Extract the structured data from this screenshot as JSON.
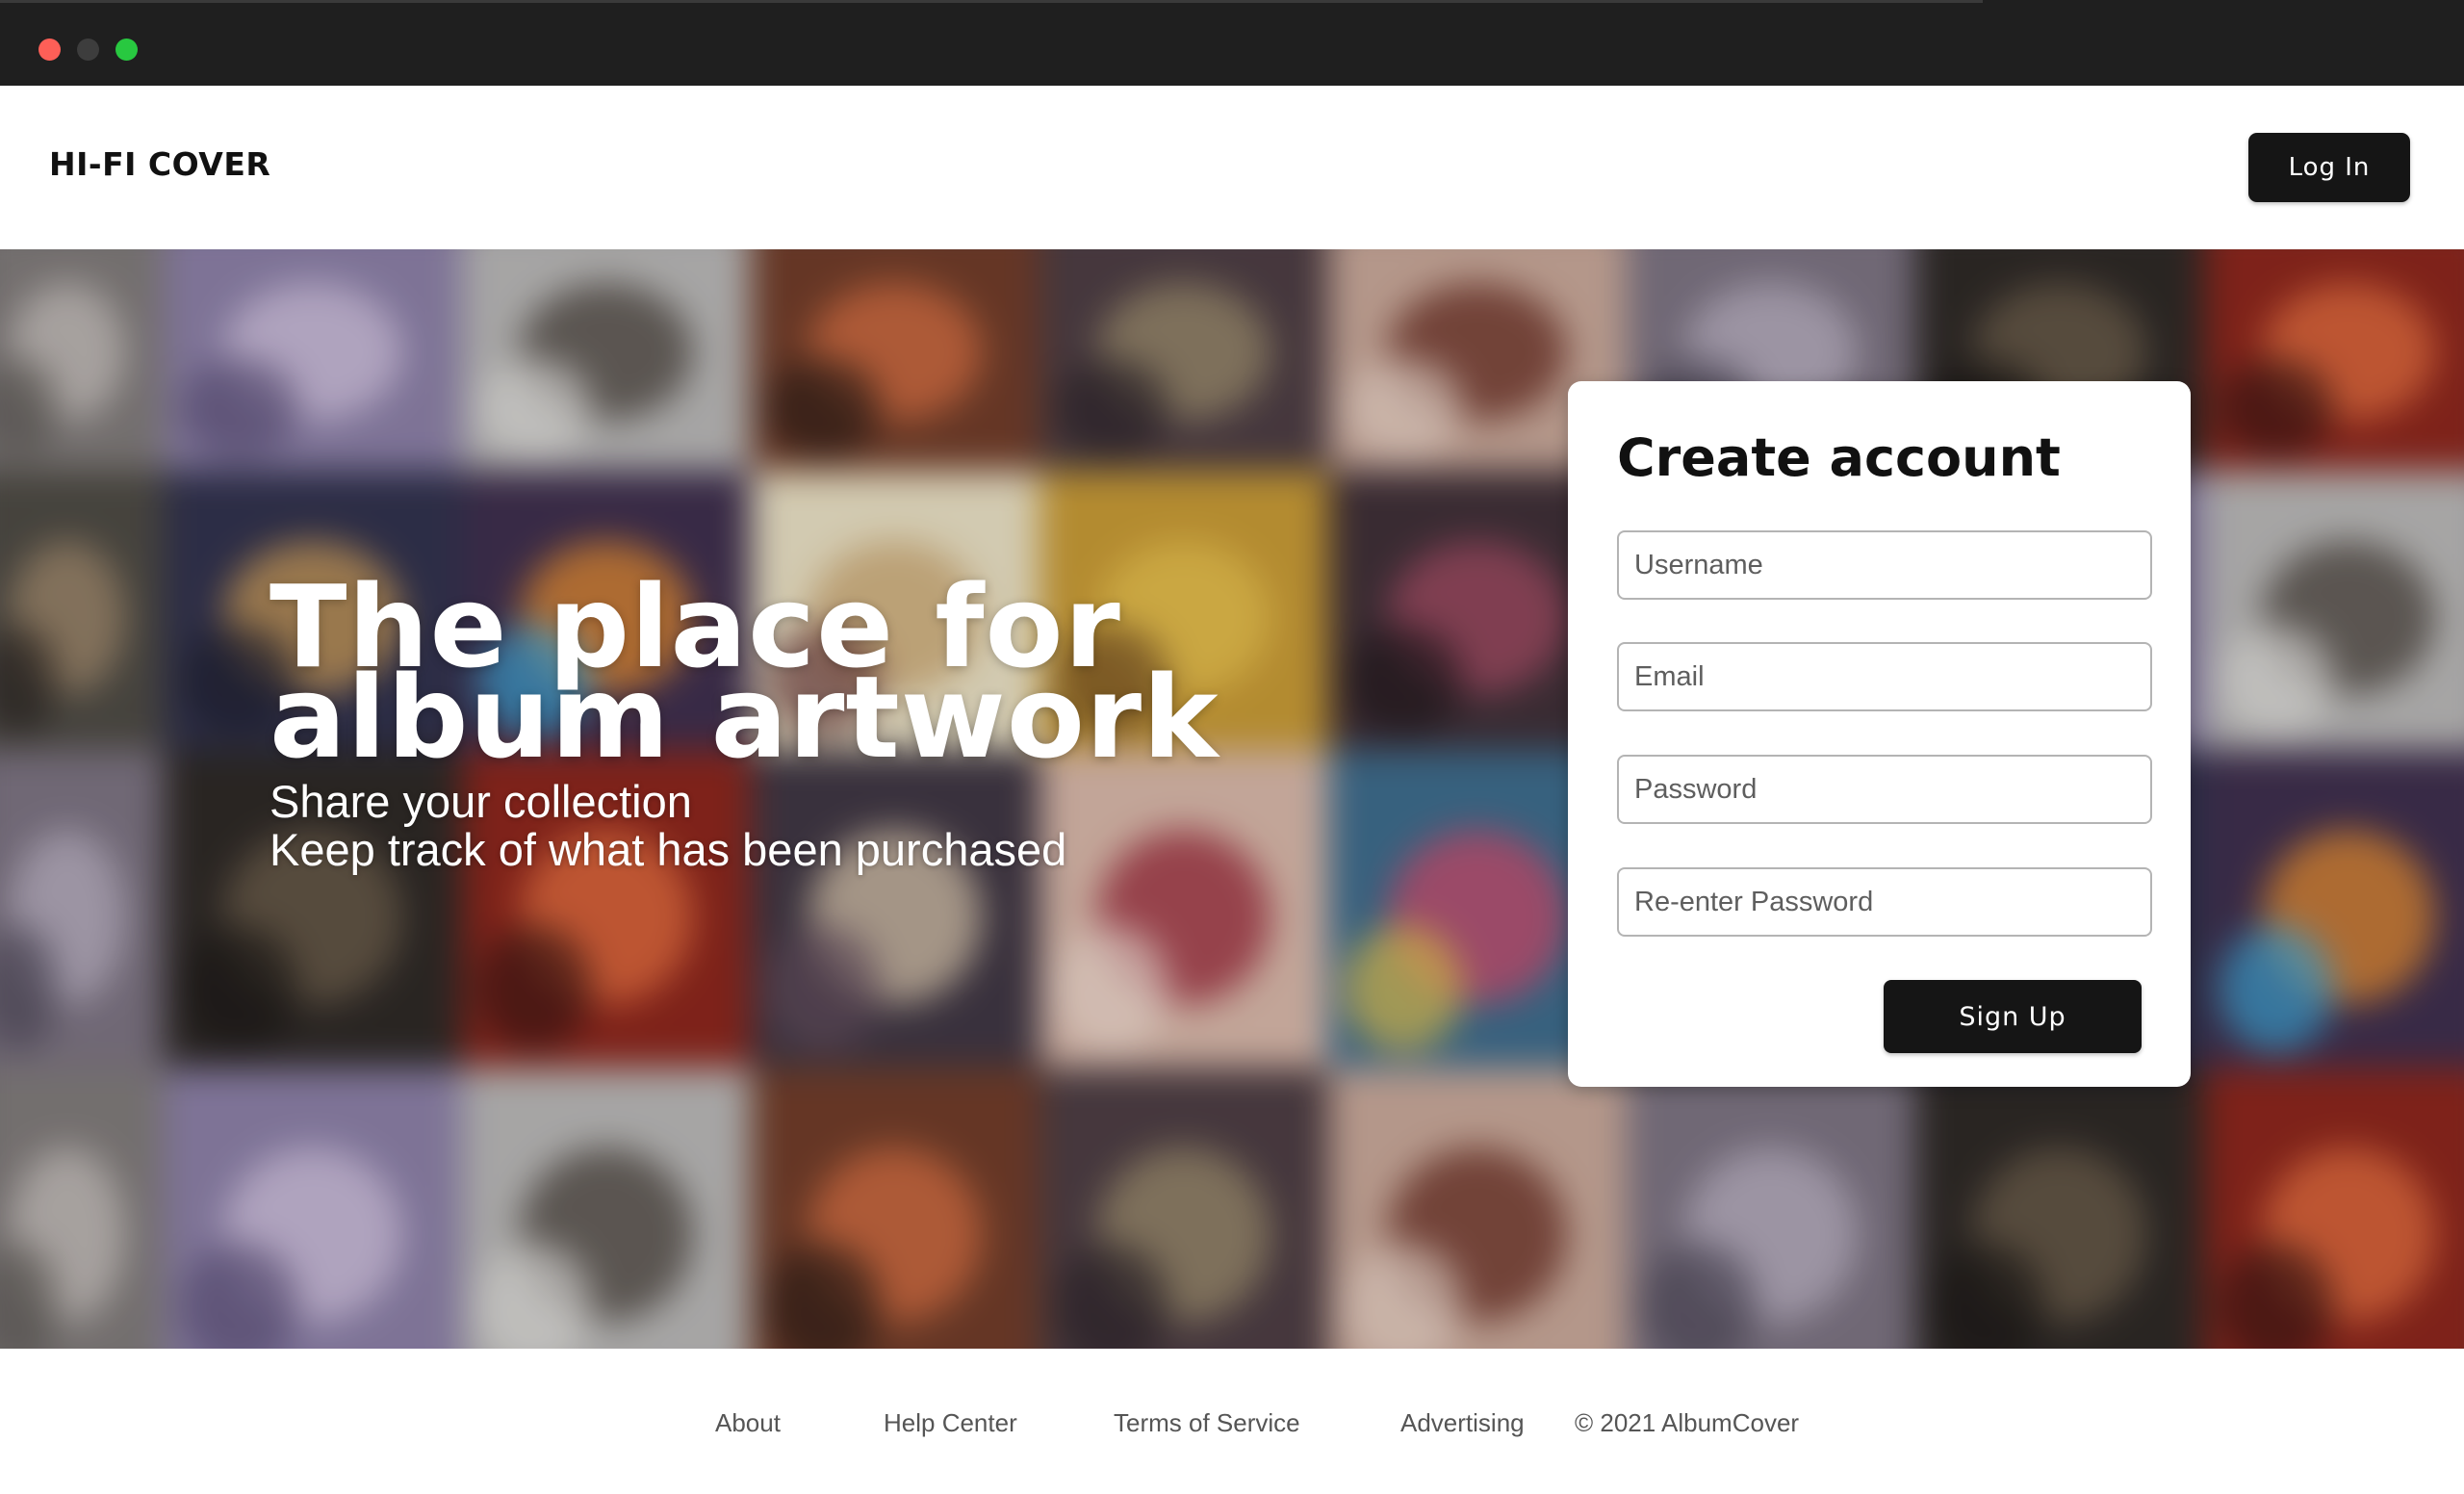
{
  "window": {
    "controls": [
      "close",
      "minimize",
      "maximize"
    ]
  },
  "header": {
    "brand": "HI-FI COVER",
    "login_label": "Log In"
  },
  "hero": {
    "headline_line1": "The place for",
    "headline_line2": "album artwork",
    "sub_line1": "Share your collection",
    "sub_line2": "Keep track of what has been purchased"
  },
  "signup_form": {
    "title": "Create account",
    "username_placeholder": "Username",
    "email_placeholder": "Email",
    "password_placeholder": "Password",
    "reenter_password_placeholder": "Re-enter Password",
    "submit_label": "Sign Up"
  },
  "footer": {
    "links": [
      "About",
      "Help Center",
      "Terms of Service",
      "Advertising"
    ],
    "copyright": "© 2021 AlbumCover"
  },
  "colors": {
    "chrome": "#1f1f1f",
    "button_dark": "#151515",
    "traffic_red": "#fe5f57",
    "traffic_green": "#28c840"
  }
}
